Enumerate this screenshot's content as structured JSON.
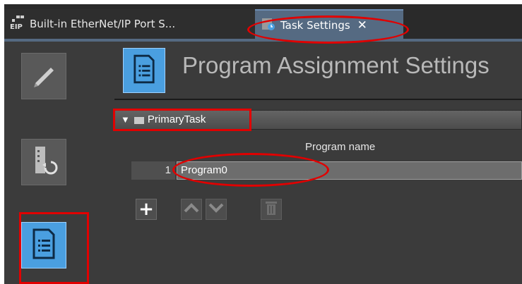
{
  "tabs": [
    {
      "label": "Built-in EtherNet/IP Port S...",
      "icon": "ethernet-ip-icon"
    },
    {
      "label": "Task Settings",
      "icon": "task-settings-icon",
      "active": true
    }
  ],
  "close_glyph": "✕",
  "header": {
    "title": "Program Assignment Settings",
    "icon": "program-list-icon"
  },
  "task": {
    "name": "PrimaryTask",
    "expanded": true
  },
  "table": {
    "column_header": "Program name",
    "rows": [
      {
        "index": "1",
        "program": "Program0"
      }
    ]
  },
  "toolbar": {
    "add_glyph": "+"
  },
  "sidebar": {
    "items": [
      {
        "icon": "pencil-icon"
      },
      {
        "icon": "transfer-icon"
      },
      {
        "icon": "program-list-icon",
        "active": true
      }
    ]
  },
  "colors": {
    "accent": "#4a9fe0",
    "annotation": "#e10000",
    "background": "#3b3b3b"
  }
}
